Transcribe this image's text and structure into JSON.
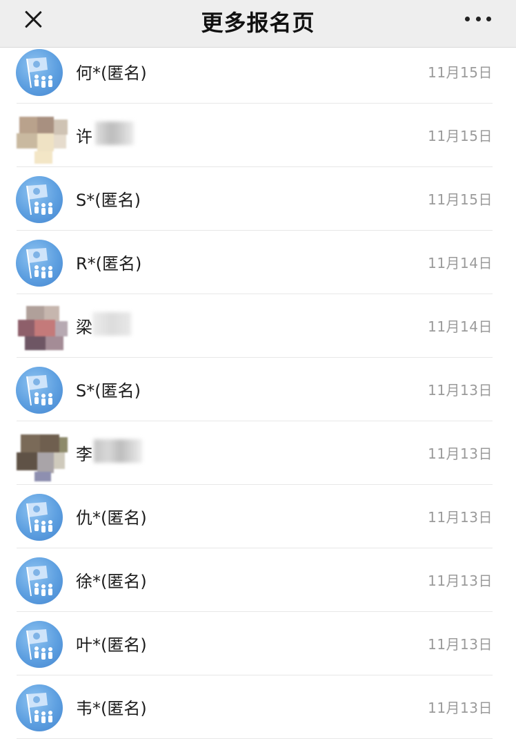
{
  "header": {
    "title": "更多报名页",
    "close_icon": "close-icon",
    "more_icon": "more-icon"
  },
  "entries": [
    {
      "name": "何*(匿名)",
      "date": "11月15日",
      "avatar": "logo"
    },
    {
      "name": "许",
      "date": "11月15日",
      "avatar": "photo-pixelated"
    },
    {
      "name": "S*(匿名)",
      "date": "11月15日",
      "avatar": "logo"
    },
    {
      "name": "R*(匿名)",
      "date": "11月14日",
      "avatar": "logo"
    },
    {
      "name": "梁",
      "date": "11月14日",
      "avatar": "photo-pixelated"
    },
    {
      "name": "S*(匿名)",
      "date": "11月13日",
      "avatar": "logo"
    },
    {
      "name": "李",
      "date": "11月13日",
      "avatar": "photo-pixelated"
    },
    {
      "name": "仇*(匿名)",
      "date": "11月13日",
      "avatar": "logo"
    },
    {
      "name": "徐*(匿名)",
      "date": "11月13日",
      "avatar": "logo"
    },
    {
      "name": "叶*(匿名)",
      "date": "11月13日",
      "avatar": "logo"
    },
    {
      "name": "韦*(匿名)",
      "date": "11月13日",
      "avatar": "logo"
    }
  ],
  "colors": {
    "header_bg": "#eeeeee",
    "logo_blue": "#5d9fe0",
    "date_gray": "#9a9a9a"
  }
}
